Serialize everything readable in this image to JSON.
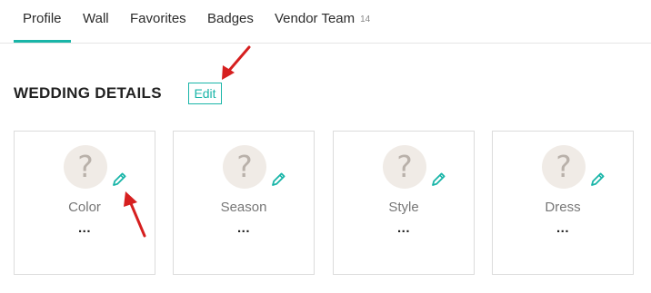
{
  "tabs": [
    {
      "label": "Profile"
    },
    {
      "label": "Wall"
    },
    {
      "label": "Favorites"
    },
    {
      "label": "Badges"
    },
    {
      "label": "Vendor Team",
      "count": "14"
    }
  ],
  "section": {
    "title": "WEDDING DETAILS",
    "edit_label": "Edit"
  },
  "cards": [
    {
      "label": "Color",
      "value": "..."
    },
    {
      "label": "Season",
      "value": "..."
    },
    {
      "label": "Style",
      "value": "..."
    },
    {
      "label": "Dress",
      "value": "..."
    }
  ],
  "icons": {
    "placeholder": "question-mark-icon",
    "edit": "pencil-icon",
    "question_glyph": "?"
  },
  "colors": {
    "accent": "#19b5a8",
    "annotation": "#d61f1f",
    "placeholder_bg": "#f0ebe6"
  }
}
